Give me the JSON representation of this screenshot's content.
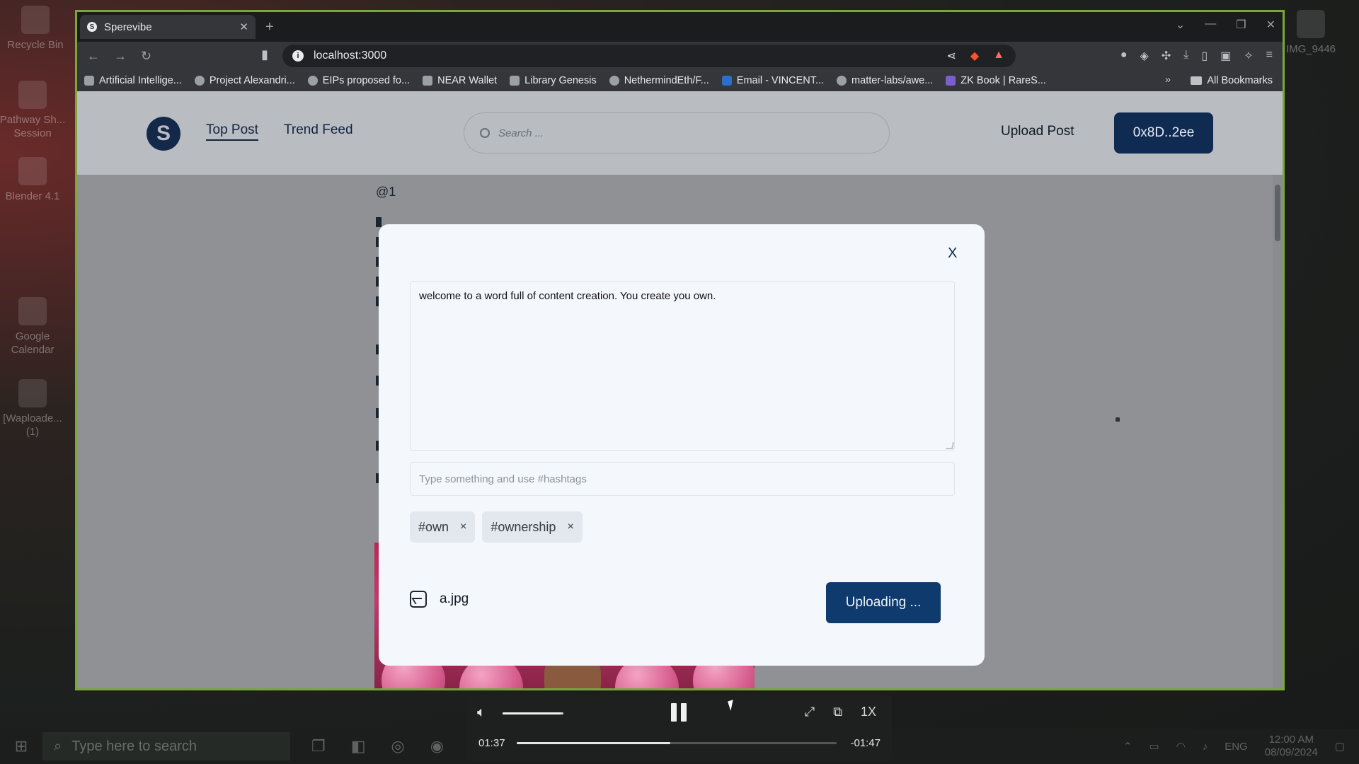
{
  "desktop": {
    "icons": [
      "Recycle Bin",
      "Pathway Sh... Session",
      "Blender 4.1",
      "Google Calendar",
      "[Waploade... (1)",
      "IMG_9446"
    ]
  },
  "taskbar": {
    "search_placeholder": "Type here to search",
    "language": "ENG",
    "time": "12:00 AM",
    "date": "08/09/2024"
  },
  "browser": {
    "tab_title": "Sperevibe",
    "url": "localhost:3000",
    "bookmarks": [
      "Artificial Intellige...",
      "Project Alexandri...",
      "EIPs proposed fo...",
      "NEAR Wallet",
      "Library Genesis",
      "NethermindEth/F...",
      "Email - VINCENT...",
      "matter-labs/awe...",
      "ZK Book | RareS..."
    ],
    "all_bookmarks": "All Bookmarks"
  },
  "site": {
    "nav": {
      "top_post": "Top Post",
      "trend_feed": "Trend Feed"
    },
    "search_placeholder": "Search ...",
    "upload_post": "Upload Post",
    "wallet": "0x8D..2ee",
    "feed": {
      "handle": "@1"
    }
  },
  "modal": {
    "close": "X",
    "post_text": "welcome to a word full of content creation. You create you own.",
    "hashtag_placeholder": "Type something and use #hashtags",
    "tags": [
      "#own",
      "#ownership"
    ],
    "tag_remove": "×",
    "file_name": "a.jpg",
    "upload_button": "Uploading ..."
  },
  "player": {
    "current_time": "01:37",
    "remaining_time": "-01:47",
    "speed": "1X",
    "progress": 0.48,
    "volume": 0.95
  }
}
